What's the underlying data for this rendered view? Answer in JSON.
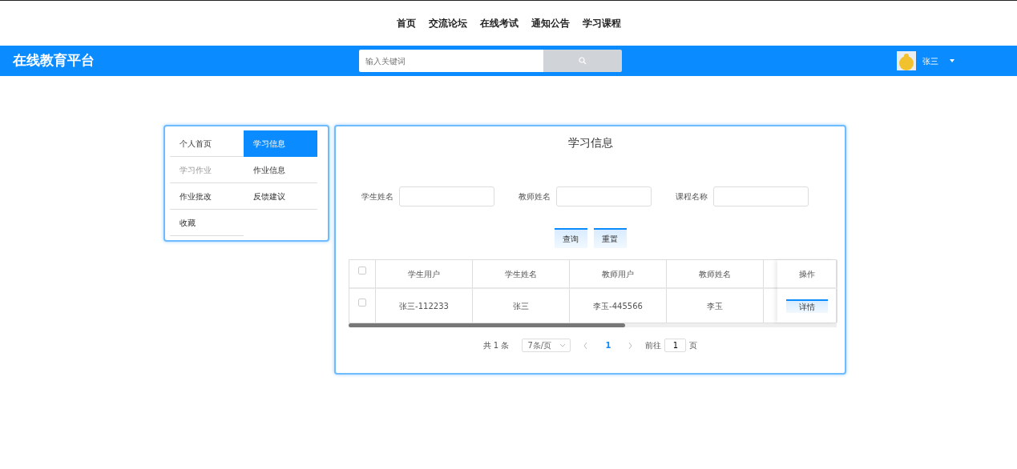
{
  "top_nav": [
    {
      "label": "首页"
    },
    {
      "label": "交流论坛"
    },
    {
      "label": "在线考试"
    },
    {
      "label": "通知公告"
    },
    {
      "label": "学习课程"
    }
  ],
  "header": {
    "brand": "在线教育平台",
    "search": {
      "placeholder": "输入关键词"
    },
    "user": {
      "name": "张三"
    }
  },
  "sidebar": {
    "items": [
      {
        "label": "个人首页",
        "selected": false,
        "hovered": false
      },
      {
        "label": "学习信息",
        "selected": true,
        "hovered": false
      },
      {
        "label": "学习作业",
        "selected": false,
        "hovered": true
      },
      {
        "label": "作业信息",
        "selected": false,
        "hovered": false
      },
      {
        "label": "作业批改",
        "selected": false,
        "hovered": false
      },
      {
        "label": "反馈建议",
        "selected": false,
        "hovered": false
      },
      {
        "label": "收藏",
        "selected": false,
        "hovered": false
      }
    ]
  },
  "main": {
    "title": "学习信息",
    "filters": [
      {
        "label": "学生姓名"
      },
      {
        "label": "教师姓名"
      },
      {
        "label": "课程名称"
      }
    ],
    "buttons": [
      "查询",
      "重置"
    ],
    "table": {
      "columns": [
        "学生用户",
        "学生姓名",
        "教师用户",
        "教师姓名"
      ],
      "action_column": "操作",
      "rows": [
        {
          "cells": [
            "张三-112233",
            "张三",
            "李玉-445566",
            "李玉"
          ],
          "checked": false,
          "action": "详情"
        }
      ],
      "header_checked": false
    },
    "pagination": {
      "total": "共 1 条",
      "page_size": "7条/页",
      "pages": [
        {
          "label": "1",
          "selected": true
        }
      ],
      "goto_label": "前往",
      "goto_value": "1",
      "goto_suffix": "页"
    }
  }
}
